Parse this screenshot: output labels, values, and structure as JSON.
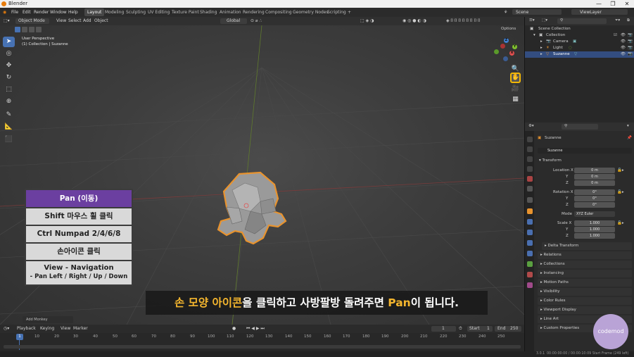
{
  "window": {
    "title": "Blender",
    "controls": [
      "—",
      "❐",
      "✕"
    ]
  },
  "menu": {
    "items": [
      "File",
      "Edit",
      "Render",
      "Window",
      "Help"
    ],
    "workspaces": [
      "Layout",
      "Modeling",
      "Sculpting",
      "UV Editing",
      "Texture Paint",
      "Shading",
      "Animation",
      "Rendering",
      "Compositing",
      "Geometry Nodes",
      "Scripting"
    ],
    "add_workspace": "+",
    "scene": "Scene",
    "view_layer": "ViewLayer"
  },
  "viewport_header": {
    "mode": "Object Mode",
    "menus": [
      "View",
      "Select",
      "Add",
      "Object"
    ],
    "transform_orientation": "Global",
    "options": "Options"
  },
  "viewport": {
    "perspective": "User Perspective",
    "collection_info": "(1) Collection | Suzanne",
    "gizmo_axes": [
      "X",
      "Y",
      "Z"
    ],
    "add_panel": "Add Monkey"
  },
  "instruction": {
    "title": "Pan (이동)",
    "rows": [
      "Shift 마우스 휠 클릭",
      "Ctrl Numpad 2/4/6/8",
      "손아이콘 클릭"
    ],
    "nav_line1": "View - Navigation",
    "nav_line2": "- Pan Left / Right / Up / Down"
  },
  "subtitle": {
    "hl1": "손 모양 아이콘",
    "part2": "을 클릭하고 사방팔방 돌려주면 ",
    "hl2": "Pan",
    "part3": "이 됩니다."
  },
  "timeline": {
    "menus": [
      "Playback",
      "Keying",
      "View",
      "Marker"
    ],
    "current_frame": "1",
    "start_label": "Start",
    "start": "1",
    "end_label": "End",
    "end": "250",
    "ticks": [
      "10",
      "20",
      "30",
      "40",
      "50",
      "60",
      "70",
      "80",
      "90",
      "100",
      "110",
      "120",
      "130",
      "140",
      "150",
      "160",
      "170",
      "180",
      "190",
      "200",
      "210",
      "220",
      "230",
      "240",
      "250"
    ],
    "playhead": "1"
  },
  "status": {
    "version": "3.0.1",
    "right": "00:00:00:00 / 00:00:10:09  Start Frame (249 left)"
  },
  "outliner": {
    "scene_collection": "Scene Collection",
    "collection": "Collection",
    "objects": [
      "Camera",
      "Light",
      "Suzanne"
    ],
    "selected": "Suzanne"
  },
  "properties": {
    "object_name": "Suzanne",
    "object_sub": "Suzanne",
    "transform_label": "Transform",
    "location_label": "Location X",
    "location": [
      "0 m",
      "0 m",
      "0 m"
    ],
    "rotation_label": "Rotation X",
    "rotation": [
      "0°",
      "0°",
      "0°"
    ],
    "mode_label": "Mode",
    "mode": "XYZ Euler",
    "scale_label": "Scale X",
    "scale": [
      "1.000",
      "1.000",
      "1.000"
    ],
    "axis_y": "Y",
    "axis_z": "Z",
    "panels": [
      "Delta Transform",
      "Relations",
      "Collections",
      "Instancing",
      "Motion Paths",
      "Visibility",
      "Color Rules",
      "Viewport Display",
      "Line Art",
      "Custom Properties"
    ]
  },
  "watermark": "codemod",
  "colors": {
    "accent": "#4772b3",
    "highlight": "#f2b705",
    "instruction_header": "#6b3fa0",
    "subtitle_highlight": "#f5b62e",
    "selection_outline": "#e8932e"
  }
}
